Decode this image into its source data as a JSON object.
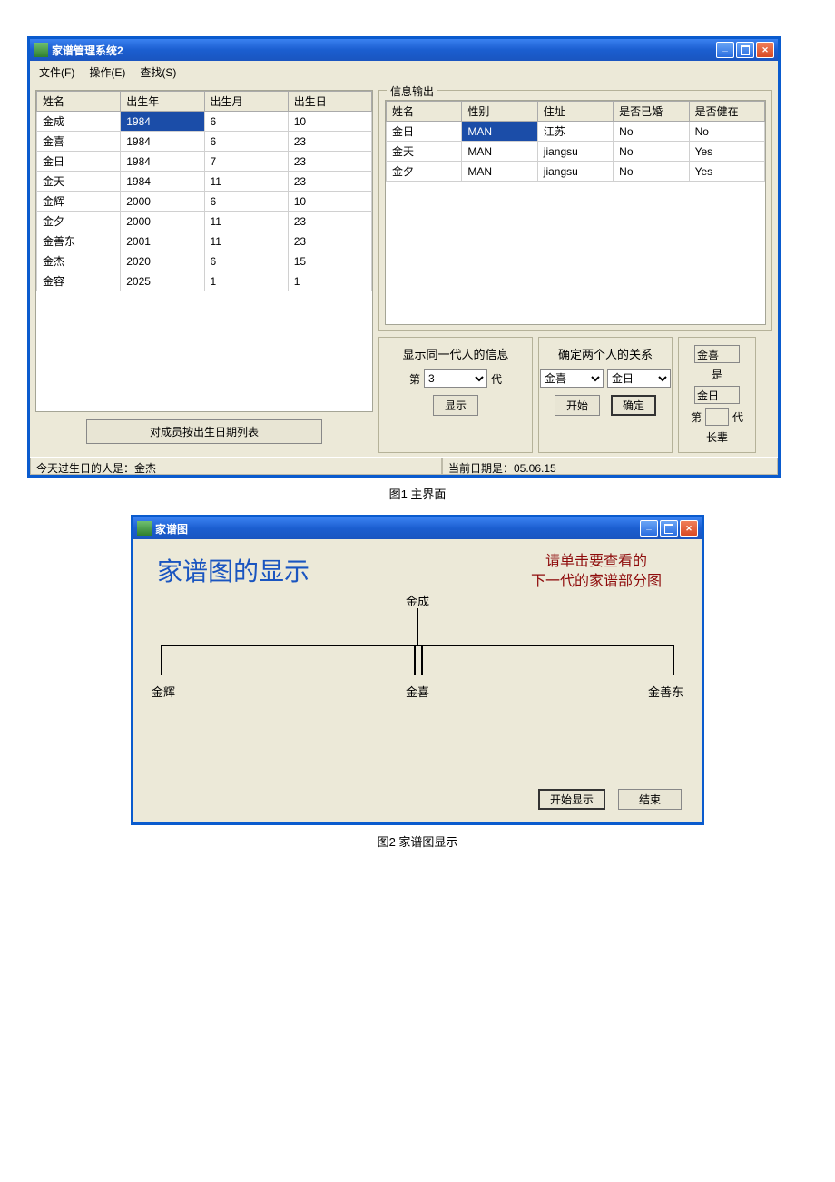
{
  "win1": {
    "title": "家谱管理系统2",
    "menu": {
      "file": "文件(F)",
      "op": "操作(E)",
      "find": "查找(S)"
    },
    "left_headers": [
      "姓名",
      "出生年",
      "出生月",
      "出生日"
    ],
    "left_rows": [
      [
        "金成",
        "1984",
        "6",
        "10"
      ],
      [
        "金喜",
        "1984",
        "6",
        "23"
      ],
      [
        "金日",
        "1984",
        "7",
        "23"
      ],
      [
        "金天",
        "1984",
        "11",
        "23"
      ],
      [
        "金辉",
        "2000",
        "6",
        "10"
      ],
      [
        "金夕",
        "2000",
        "11",
        "23"
      ],
      [
        "金善东",
        "2001",
        "11",
        "23"
      ],
      [
        "金杰",
        "2020",
        "6",
        "15"
      ],
      [
        "金容",
        "2025",
        "1",
        "1"
      ]
    ],
    "sort_btn": "对成员按出生日期列表",
    "info_group": "信息输出",
    "right_headers": [
      "姓名",
      "性别",
      "住址",
      "是否已婚",
      "是否健在"
    ],
    "right_rows": [
      [
        "金日",
        "MAN",
        "江苏",
        "No",
        "No"
      ],
      [
        "金天",
        "MAN",
        "jiangsu",
        "No",
        "Yes"
      ],
      [
        "金夕",
        "MAN",
        "jiangsu",
        "No",
        "Yes"
      ]
    ],
    "same_gen": {
      "title": "显示同一代人的信息",
      "pre": "第",
      "post": "代",
      "value": "3",
      "btn": "显示"
    },
    "relation": {
      "title": "确定两个人的关系",
      "p1": "金喜",
      "p2": "金日",
      "start": "开始",
      "ok": "确定"
    },
    "result": {
      "a": "金喜",
      "is": "是",
      "b": "金日",
      "pre": "第",
      "gen": "",
      "post": "代",
      "elder": "长辈"
    },
    "status": {
      "left": "今天过生日的人是：金杰",
      "right": "当前日期是：05.06.15"
    }
  },
  "caption1": "图1 主界面",
  "win2": {
    "title": "家谱图",
    "bigtitle": "家谱图的显示",
    "hint_l1": "请单击要查看的",
    "hint_l2": "下一代的家谱部分图",
    "root": "金成",
    "leaf_left": "金辉",
    "leaf_mid": "金喜",
    "leaf_right": "金善东",
    "btn_show": "开始显示",
    "btn_end": "结束"
  },
  "caption2": "图2 家谱图显示"
}
